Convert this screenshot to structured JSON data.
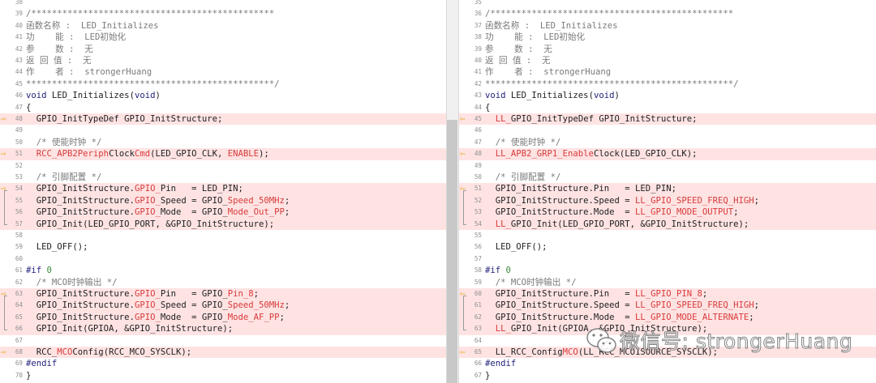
{
  "left_pane": {
    "lines": [
      {
        "ln": "38",
        "diff": false,
        "marker": "",
        "segs": []
      },
      {
        "ln": "39",
        "diff": false,
        "marker": "",
        "segs": [
          {
            "t": "/***********************************************",
            "c": "cm"
          }
        ]
      },
      {
        "ln": "40",
        "diff": false,
        "marker": "",
        "segs": [
          {
            "t": "函数名称 :  LED_Initializes",
            "c": "cm"
          }
        ]
      },
      {
        "ln": "41",
        "diff": false,
        "marker": "",
        "segs": [
          {
            "t": "功    能 :  LED初始化",
            "c": "cm"
          }
        ]
      },
      {
        "ln": "42",
        "diff": false,
        "marker": "",
        "segs": [
          {
            "t": "参    数 :  无",
            "c": "cm"
          }
        ]
      },
      {
        "ln": "43",
        "diff": false,
        "marker": "",
        "segs": [
          {
            "t": "返 回 值 :  无",
            "c": "cm"
          }
        ]
      },
      {
        "ln": "44",
        "diff": false,
        "marker": "",
        "segs": [
          {
            "t": "作    者 :  strongerHuang",
            "c": "cm"
          }
        ]
      },
      {
        "ln": "45",
        "diff": false,
        "marker": "",
        "segs": [
          {
            "t": "************************************************/",
            "c": "cm"
          }
        ]
      },
      {
        "ln": "46",
        "diff": false,
        "marker": "",
        "segs": [
          {
            "t": "void",
            "c": "kw"
          },
          {
            "t": " LED_Initializes(",
            "c": ""
          },
          {
            "t": "void",
            "c": "kw"
          },
          {
            "t": ")",
            "c": ""
          }
        ]
      },
      {
        "ln": "47",
        "diff": false,
        "marker": "",
        "segs": [
          {
            "t": "{",
            "c": ""
          }
        ]
      },
      {
        "ln": "48",
        "diff": true,
        "marker": "arrow",
        "segs": [
          {
            "t": "  GPIO_InitTypeDef GPIO_InitStructure;",
            "c": ""
          }
        ]
      },
      {
        "ln": "49",
        "diff": false,
        "marker": "",
        "segs": []
      },
      {
        "ln": "50",
        "diff": false,
        "marker": "",
        "segs": [
          {
            "t": "  /* 使能时钟 */",
            "c": "cm"
          }
        ]
      },
      {
        "ln": "51",
        "diff": true,
        "marker": "arrow",
        "segs": [
          {
            "t": "  RCC_APB2",
            "c": "hl"
          },
          {
            "t": "Periph",
            "c": "hl"
          },
          {
            "t": "Clock",
            "c": ""
          },
          {
            "t": "Cmd",
            "c": "hl"
          },
          {
            "t": "(LED_GPIO_CLK, ",
            "c": ""
          },
          {
            "t": "ENABLE",
            "c": "hl"
          },
          {
            "t": ");",
            "c": ""
          }
        ]
      },
      {
        "ln": "52",
        "diff": false,
        "marker": "",
        "segs": []
      },
      {
        "ln": "53",
        "diff": false,
        "marker": "",
        "segs": [
          {
            "t": "  /* 引脚配置 */",
            "c": "cm"
          }
        ]
      },
      {
        "ln": "54",
        "diff": true,
        "marker": "arrow-bracket",
        "segs": [
          {
            "t": "  GPIO_InitStructure.",
            "c": ""
          },
          {
            "t": "GPIO_",
            "c": "hl"
          },
          {
            "t": "Pin   = LED_PIN;",
            "c": ""
          }
        ]
      },
      {
        "ln": "55",
        "diff": true,
        "marker": "bracket",
        "segs": [
          {
            "t": "  GPIO_InitStructure.",
            "c": ""
          },
          {
            "t": "GPIO_",
            "c": "hl"
          },
          {
            "t": "Speed = GPIO_",
            "c": ""
          },
          {
            "t": "Speed_50MHz",
            "c": "hl"
          },
          {
            "t": ";",
            "c": ""
          }
        ]
      },
      {
        "ln": "56",
        "diff": true,
        "marker": "bracket",
        "segs": [
          {
            "t": "  GPIO_InitStructure.",
            "c": ""
          },
          {
            "t": "GPIO_",
            "c": "hl"
          },
          {
            "t": "Mode  = GPIO_",
            "c": ""
          },
          {
            "t": "Mode_Out_PP",
            "c": "hl"
          },
          {
            "t": ";",
            "c": ""
          }
        ]
      },
      {
        "ln": "57",
        "diff": true,
        "marker": "bracket-last",
        "segs": [
          {
            "t": "  GPIO_Init(LED_GPIO_PORT, &GPIO_InitStructure);",
            "c": ""
          }
        ]
      },
      {
        "ln": "58",
        "diff": false,
        "marker": "",
        "segs": []
      },
      {
        "ln": "59",
        "diff": false,
        "marker": "",
        "segs": [
          {
            "t": "  LED_OFF();",
            "c": ""
          }
        ]
      },
      {
        "ln": "60",
        "diff": false,
        "marker": "",
        "segs": []
      },
      {
        "ln": "61",
        "diff": false,
        "marker": "",
        "segs": [
          {
            "t": "#if ",
            "c": "kw"
          },
          {
            "t": "0",
            "c": "num"
          }
        ]
      },
      {
        "ln": "62",
        "diff": false,
        "marker": "",
        "segs": [
          {
            "t": "  /* MCO时钟输出 */",
            "c": "cm"
          }
        ]
      },
      {
        "ln": "63",
        "diff": true,
        "marker": "arrow-bracket",
        "segs": [
          {
            "t": "  GPIO_InitStructure.",
            "c": ""
          },
          {
            "t": "GPIO_",
            "c": "hl"
          },
          {
            "t": "Pin   = GPIO_",
            "c": ""
          },
          {
            "t": "Pin_8",
            "c": "hl"
          },
          {
            "t": ";",
            "c": ""
          }
        ]
      },
      {
        "ln": "64",
        "diff": true,
        "marker": "bracket",
        "segs": [
          {
            "t": "  GPIO_InitStructure.",
            "c": ""
          },
          {
            "t": "GPIO_",
            "c": "hl"
          },
          {
            "t": "Speed = GPIO_",
            "c": ""
          },
          {
            "t": "Speed_50MHz",
            "c": "hl"
          },
          {
            "t": ";",
            "c": ""
          }
        ]
      },
      {
        "ln": "65",
        "diff": true,
        "marker": "bracket",
        "segs": [
          {
            "t": "  GPIO_InitStructure.",
            "c": ""
          },
          {
            "t": "GPIO_",
            "c": "hl"
          },
          {
            "t": "Mode  = GPIO_",
            "c": ""
          },
          {
            "t": "Mode_AF_PP",
            "c": "hl"
          },
          {
            "t": ";",
            "c": ""
          }
        ]
      },
      {
        "ln": "66",
        "diff": true,
        "marker": "bracket-last",
        "segs": [
          {
            "t": "  GPIO_Init(GPIOA, &GPIO_InitStructure);",
            "c": ""
          }
        ]
      },
      {
        "ln": "67",
        "diff": false,
        "marker": "",
        "segs": []
      },
      {
        "ln": "68",
        "diff": true,
        "marker": "arrow",
        "segs": [
          {
            "t": "  RCC_",
            "c": ""
          },
          {
            "t": "MCO",
            "c": "hl"
          },
          {
            "t": "Config(RCC_MCO_SYSCLK);",
            "c": ""
          }
        ]
      },
      {
        "ln": "69",
        "diff": false,
        "marker": "",
        "segs": [
          {
            "t": "#endif",
            "c": "kw"
          }
        ]
      },
      {
        "ln": "70",
        "diff": false,
        "marker": "",
        "segs": [
          {
            "t": "}",
            "c": ""
          }
        ]
      }
    ]
  },
  "right_pane": {
    "lines": [
      {
        "ln": "35",
        "diff": false,
        "marker": "",
        "segs": []
      },
      {
        "ln": "36",
        "diff": false,
        "marker": "",
        "segs": [
          {
            "t": "/***********************************************",
            "c": "cm"
          }
        ]
      },
      {
        "ln": "37",
        "diff": false,
        "marker": "",
        "segs": [
          {
            "t": "函数名称 :  LED_Initializes",
            "c": "cm"
          }
        ]
      },
      {
        "ln": "38",
        "diff": false,
        "marker": "",
        "segs": [
          {
            "t": "功    能 :  LED初始化",
            "c": "cm"
          }
        ]
      },
      {
        "ln": "39",
        "diff": false,
        "marker": "",
        "segs": [
          {
            "t": "参    数 :  无",
            "c": "cm"
          }
        ]
      },
      {
        "ln": "40",
        "diff": false,
        "marker": "",
        "segs": [
          {
            "t": "返 回 值 :  无",
            "c": "cm"
          }
        ]
      },
      {
        "ln": "41",
        "diff": false,
        "marker": "",
        "segs": [
          {
            "t": "作    者 :  strongerHuang",
            "c": "cm"
          }
        ]
      },
      {
        "ln": "42",
        "diff": false,
        "marker": "",
        "segs": [
          {
            "t": "************************************************/",
            "c": "cm"
          }
        ]
      },
      {
        "ln": "43",
        "diff": false,
        "marker": "",
        "segs": [
          {
            "t": "void",
            "c": "kw"
          },
          {
            "t": " LED_Initializes(",
            "c": ""
          },
          {
            "t": "void",
            "c": "kw"
          },
          {
            "t": ")",
            "c": ""
          }
        ]
      },
      {
        "ln": "44",
        "diff": false,
        "marker": "",
        "segs": [
          {
            "t": "{",
            "c": ""
          }
        ]
      },
      {
        "ln": "45",
        "diff": true,
        "marker": "arrow",
        "segs": [
          {
            "t": "  ",
            "c": ""
          },
          {
            "t": "LL_",
            "c": "hl"
          },
          {
            "t": "GPIO_InitTypeDef GPIO_InitStructure;",
            "c": ""
          }
        ]
      },
      {
        "ln": "46",
        "diff": false,
        "marker": "",
        "segs": []
      },
      {
        "ln": "47",
        "diff": false,
        "marker": "",
        "segs": [
          {
            "t": "  /* 使能时钟 */",
            "c": "cm"
          }
        ]
      },
      {
        "ln": "48",
        "diff": true,
        "marker": "arrow",
        "segs": [
          {
            "t": "  LL_APB2_",
            "c": "hl"
          },
          {
            "t": "GRP1_Enable",
            "c": "hl"
          },
          {
            "t": "Clock(LED_GPIO_CLK);",
            "c": ""
          }
        ]
      },
      {
        "ln": "49",
        "diff": false,
        "marker": "",
        "segs": []
      },
      {
        "ln": "50",
        "diff": false,
        "marker": "",
        "segs": [
          {
            "t": "  /* 引脚配置 */",
            "c": "cm"
          }
        ]
      },
      {
        "ln": "51",
        "diff": true,
        "marker": "arrow-bracket",
        "segs": [
          {
            "t": "  GPIO_InitStructure.Pin   = LED_PIN;",
            "c": ""
          }
        ]
      },
      {
        "ln": "52",
        "diff": true,
        "marker": "bracket",
        "segs": [
          {
            "t": "  GPIO_InitStructure.Speed = ",
            "c": ""
          },
          {
            "t": "LL_GPIO_SPEED_FREQ_HIGH",
            "c": "hl"
          },
          {
            "t": ";",
            "c": ""
          }
        ]
      },
      {
        "ln": "53",
        "diff": true,
        "marker": "bracket",
        "segs": [
          {
            "t": "  GPIO_InitStructure.Mode  = ",
            "c": ""
          },
          {
            "t": "LL_GPIO_MODE_OUTPUT",
            "c": "hl"
          },
          {
            "t": ";",
            "c": ""
          }
        ]
      },
      {
        "ln": "54",
        "diff": true,
        "marker": "bracket-last",
        "segs": [
          {
            "t": "  ",
            "c": ""
          },
          {
            "t": "LL_",
            "c": "hl"
          },
          {
            "t": "GPIO_Init(LED_GPIO_PORT, &GPIO_InitStructure);",
            "c": ""
          }
        ]
      },
      {
        "ln": "55",
        "diff": false,
        "marker": "",
        "segs": []
      },
      {
        "ln": "56",
        "diff": false,
        "marker": "",
        "segs": [
          {
            "t": "  LED_OFF();",
            "c": ""
          }
        ]
      },
      {
        "ln": "57",
        "diff": false,
        "marker": "",
        "segs": []
      },
      {
        "ln": "58",
        "diff": false,
        "marker": "",
        "segs": [
          {
            "t": "#if ",
            "c": "kw"
          },
          {
            "t": "0",
            "c": "num"
          }
        ]
      },
      {
        "ln": "59",
        "diff": false,
        "marker": "",
        "segs": [
          {
            "t": "  /* MCO时钟输出 */",
            "c": "cm"
          }
        ]
      },
      {
        "ln": "60",
        "diff": true,
        "marker": "arrow-bracket",
        "segs": [
          {
            "t": "  GPIO_InitStructure.Pin   = ",
            "c": ""
          },
          {
            "t": "LL_GPIO_PIN_8",
            "c": "hl"
          },
          {
            "t": ";",
            "c": ""
          }
        ]
      },
      {
        "ln": "61",
        "diff": true,
        "marker": "bracket",
        "segs": [
          {
            "t": "  GPIO_InitStructure.Speed = ",
            "c": ""
          },
          {
            "t": "LL_GPIO_SPEED_FREQ_HIGH",
            "c": "hl"
          },
          {
            "t": ";",
            "c": ""
          }
        ]
      },
      {
        "ln": "62",
        "diff": true,
        "marker": "bracket",
        "segs": [
          {
            "t": "  GPIO_InitStructure.Mode  = ",
            "c": ""
          },
          {
            "t": "LL_GPIO_MODE_ALTERNATE",
            "c": "hl"
          },
          {
            "t": ";",
            "c": ""
          }
        ]
      },
      {
        "ln": "63",
        "diff": true,
        "marker": "bracket-last",
        "segs": [
          {
            "t": "  ",
            "c": ""
          },
          {
            "t": "LL_",
            "c": "hl"
          },
          {
            "t": "GPIO_Init(GPIOA, &GPIO_InitStructure);",
            "c": ""
          }
        ]
      },
      {
        "ln": "64",
        "diff": false,
        "marker": "",
        "segs": []
      },
      {
        "ln": "65",
        "diff": true,
        "marker": "arrow",
        "segs": [
          {
            "t": "  LL_RCC_Config",
            "c": ""
          },
          {
            "t": "MCO",
            "c": "hl"
          },
          {
            "t": "(LL_RCC_MCO1SOURCE_SYSCLK);",
            "c": ""
          }
        ]
      },
      {
        "ln": "66",
        "diff": false,
        "marker": "",
        "segs": [
          {
            "t": "#endif",
            "c": "kw"
          }
        ]
      },
      {
        "ln": "67",
        "diff": false,
        "marker": "",
        "segs": [
          {
            "t": "}",
            "c": ""
          }
        ]
      }
    ]
  },
  "watermark": {
    "text": "微信号: strongerHuang"
  },
  "colors": {
    "diff_bg": "#ffe3e3",
    "highlight": "#d83a3a",
    "arrow": "#e6a817",
    "comment": "#7a7a7a",
    "line_number": "#8e8e8e"
  },
  "icons": {
    "diff_marker": "right-arrow-icon",
    "right_diff_marker": "left-arrow-icon",
    "watermark": "wechat-logo-icon"
  }
}
